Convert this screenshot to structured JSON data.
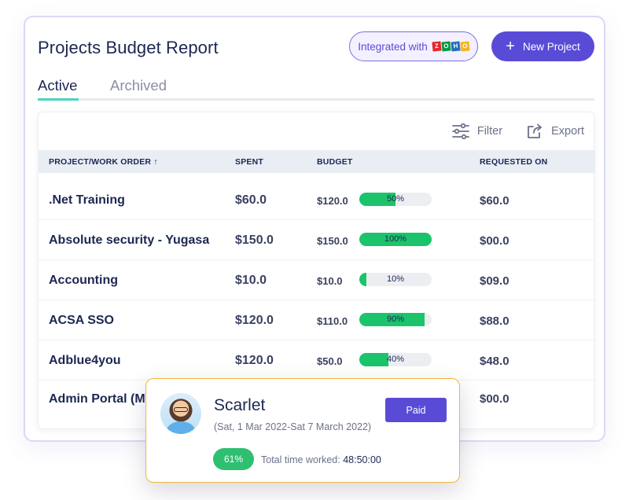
{
  "header": {
    "title": "Projects Budget Report",
    "integrated_label": "Integrated with",
    "integrated_logo_letters": [
      "Z",
      "O",
      "H",
      "O"
    ],
    "new_project_label": "New Project"
  },
  "tabs": [
    {
      "label": "Active",
      "active": true
    },
    {
      "label": "Archived",
      "active": false
    }
  ],
  "toolbar": {
    "filter_label": "Filter",
    "export_label": "Export"
  },
  "table": {
    "columns": [
      "PROJECT/WORK ORDER ↑",
      "SPENT",
      "BUDGET",
      "REQUESTED ON"
    ],
    "rows": [
      {
        "name": ".Net Training",
        "spent": "$60.0",
        "budget": "$120.0",
        "progress": 50,
        "progress_label": "50%",
        "requested": "$60.0"
      },
      {
        "name": "Absolute security - Yugasa",
        "spent": "$150.0",
        "budget": "$150.0",
        "progress": 100,
        "progress_label": "100%",
        "requested": "$00.0"
      },
      {
        "name": "Accounting",
        "spent": "$10.0",
        "budget": "$10.0",
        "progress": 10,
        "progress_label": "10%",
        "requested": "$09.0"
      },
      {
        "name": "ACSA SSO",
        "spent": "$120.0",
        "budget": "$110.0",
        "progress": 90,
        "progress_label": "90%",
        "requested": "$88.0"
      },
      {
        "name": "Adblue4you",
        "spent": "$120.0",
        "budget": "$50.0",
        "progress": 40,
        "progress_label": "40%",
        "requested": "$48.0"
      },
      {
        "name": "Admin Portal (Mi",
        "spent": "",
        "budget": "",
        "progress": null,
        "progress_label": "",
        "requested": "$00.0"
      }
    ]
  },
  "popup": {
    "name": "Scarlet",
    "dates": "(Sat, 1 Mar 2022-Sat 7 March 2022)",
    "status": "Paid",
    "percent": "61%",
    "time_label": "Total time worked:",
    "time_value": "48:50:00"
  },
  "colors": {
    "accent": "#5a4bd6",
    "progress": "#1bc46b",
    "tab_underline": "#4fd1c5",
    "popup_border": "#f2b53a"
  }
}
